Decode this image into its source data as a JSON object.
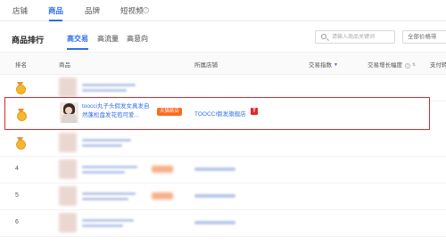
{
  "top_tabs": [
    "店铺",
    "商品",
    "品牌",
    "短视频"
  ],
  "panel": {
    "title": "商品排行",
    "sub_tabs": [
      "高交易",
      "高流量",
      "高意向"
    ],
    "search_placeholder": "请输入商品关键词",
    "category_select": "全部价格带"
  },
  "table": {
    "headers": {
      "rank": "排名",
      "product": "商品",
      "shop": "所属店铺",
      "trade_index": "交易指数",
      "trade_growth": "交易增长幅度",
      "conversion": "支付转"
    },
    "rows": [
      {
        "rank": "",
        "medal": "gold"
      },
      {
        "rank": "",
        "medal": "gold",
        "highlighted": true,
        "product_name": "toocci丸子头假发女真发自然蓬松盘发花苞可爱...",
        "tag": "天猫新店",
        "shop_name": "TOOCCI假发旗舰店",
        "shop_icon": "T"
      },
      {
        "rank": "",
        "medal": "gold"
      },
      {
        "rank": "4"
      },
      {
        "rank": "5"
      },
      {
        "rank": "6"
      }
    ]
  },
  "colors": {
    "accent": "#2f6fe8",
    "highlight": "#e1262b",
    "tag": "#ff6a1f",
    "medal": "#f5b731"
  }
}
